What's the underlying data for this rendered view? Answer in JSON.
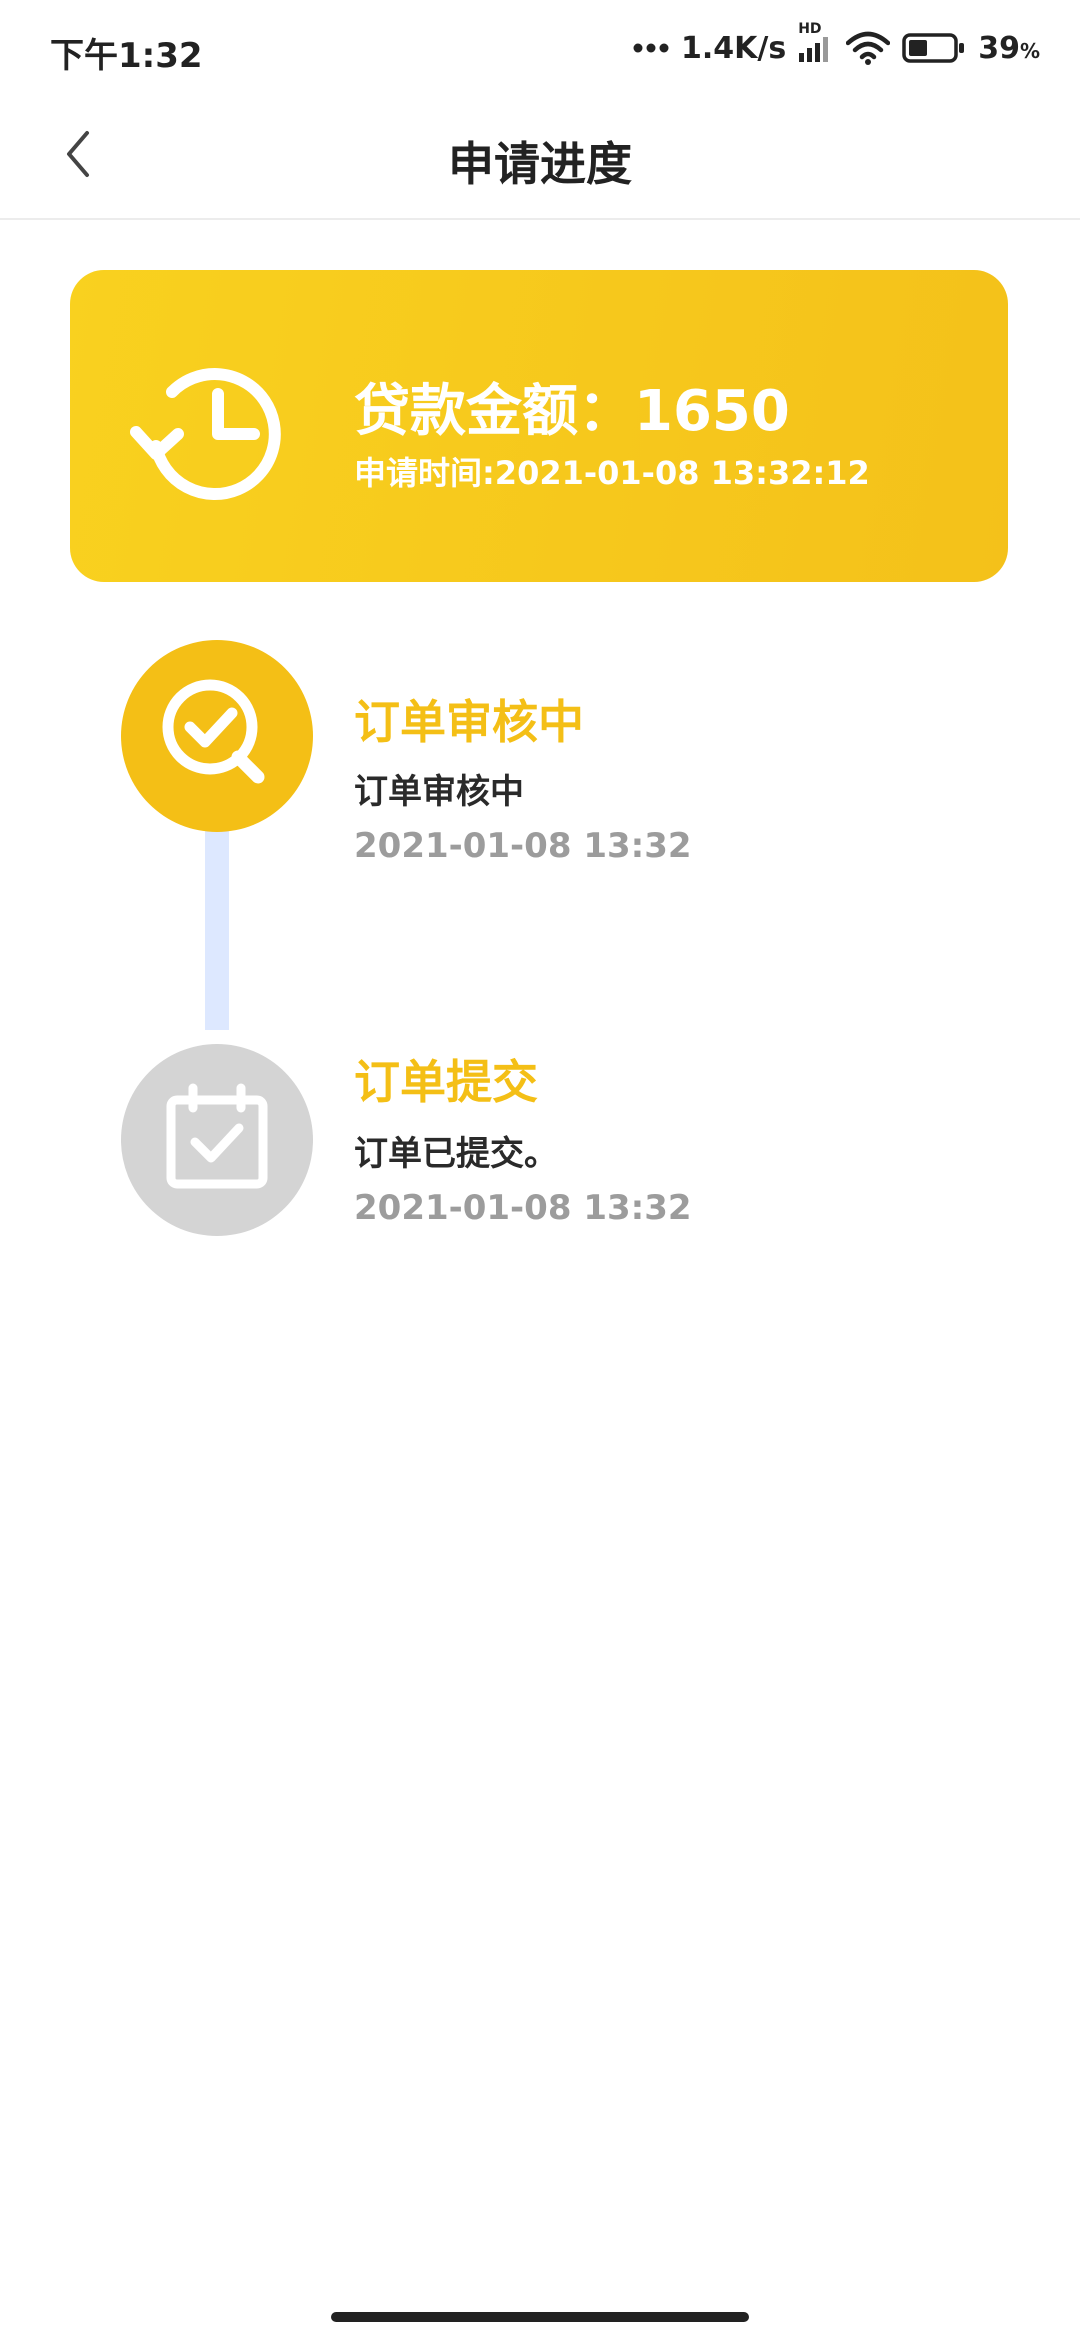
{
  "status_bar": {
    "time": "下午1:32",
    "network_speed": "1.4K/s",
    "network_badge": "HD",
    "battery_percent": "39",
    "battery_unit": "%",
    "icons": [
      "more-dots-icon",
      "signal-icon",
      "wifi-icon",
      "battery-icon"
    ]
  },
  "nav": {
    "title": "申请进度",
    "back_icon": "chevron-left-icon"
  },
  "loan_card": {
    "amount_label": "贷款金额：",
    "amount_value": "1650",
    "time_label": "申请时间:2021-01-08 13:32:12",
    "icon": "history-clock-icon",
    "background_color": "#f7c71c"
  },
  "timeline": {
    "line_color": "#dde8ff",
    "items": [
      {
        "title": "订单审核中",
        "description": "订单审核中",
        "date": "2021-01-08 13:32",
        "icon": "search-check-icon",
        "state": "active"
      },
      {
        "title": "订单提交",
        "description": "订单已提交。",
        "date": "2021-01-08 13:32",
        "icon": "calendar-check-icon",
        "state": "inactive"
      }
    ]
  },
  "colors": {
    "accent": "#f4bf16",
    "inactive": "#d4d4d4",
    "date_text": "#9c9c9c"
  }
}
